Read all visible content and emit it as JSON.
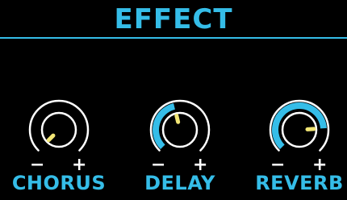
{
  "header": {
    "title": "EFFECT"
  },
  "colors": {
    "accent": "#35bde8",
    "indicator": "#f2e675",
    "ring": "#ffffff",
    "background": "#000000"
  },
  "knobs": [
    {
      "label": "CHORUS",
      "minus": "−",
      "plus": "+",
      "level": 0.0
    },
    {
      "label": "DELAY",
      "minus": "−",
      "plus": "+",
      "level": 0.45
    },
    {
      "label": "REVERB",
      "minus": "−",
      "plus": "+",
      "level": 0.82
    }
  ]
}
